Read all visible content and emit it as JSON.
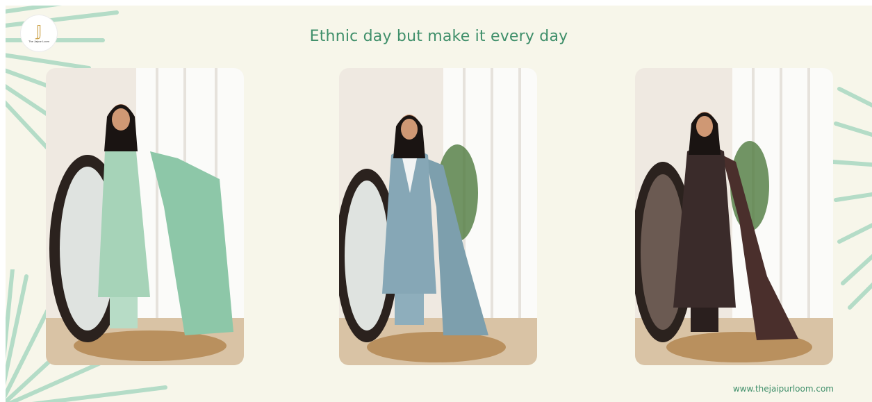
{
  "headline": "Ethnic day but make it every day",
  "website": "www.thejaipurloom.com",
  "logo": {
    "text": "The Jaipur Loom"
  },
  "colors": {
    "background": "#f7f6ea",
    "accent_green": "#3f8f6a",
    "palm": "#a9d8c1"
  },
  "photos": [
    {
      "outfit": "mint-green-printed-suit",
      "primary": "#a6d3b8",
      "secondary": "#6fb99c",
      "dupatta": "#8dc7a8"
    },
    {
      "outfit": "dusty-blue-embroidered-suit",
      "primary": "#86a7b6",
      "secondary": "#6b8e9e",
      "dupatta": "#7d9fad"
    },
    {
      "outfit": "black-printed-anarkali",
      "primary": "#3a2b2a",
      "secondary": "#2a1f1e",
      "dupatta": "#4a2f2c"
    }
  ]
}
